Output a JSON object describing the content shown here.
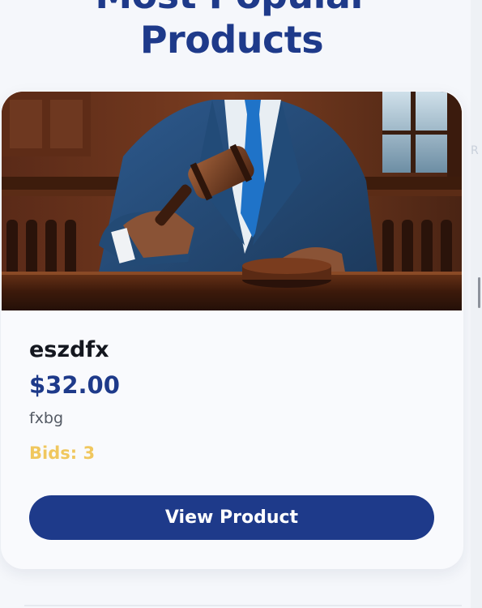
{
  "section": {
    "title_line1": "Most Popular",
    "title_line2": "Products"
  },
  "product": {
    "image_alt": "Judge holding a wooden gavel",
    "name": "eszdfx",
    "price": "$32.00",
    "description": "fxbg",
    "bids": "Bids: 3",
    "button_label": "View Product"
  },
  "side_peek_text": "R",
  "colors": {
    "brand_navy": "#1e3a8a",
    "bids_gold": "#f0c75e",
    "card_bg": "#f9fafd",
    "page_bg": "#f5f7fb"
  }
}
